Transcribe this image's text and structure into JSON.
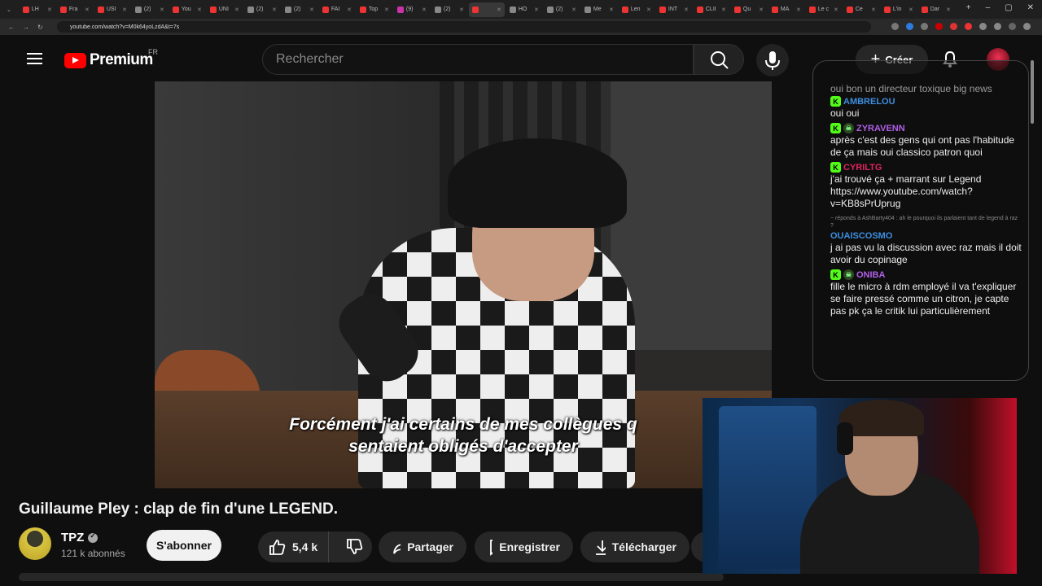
{
  "browser": {
    "tabs": [
      {
        "label": "LH",
        "color": "#e33"
      },
      {
        "label": "Fra",
        "color": "#e33"
      },
      {
        "label": "USI",
        "color": "#e33"
      },
      {
        "label": "(2)",
        "color": "#888"
      },
      {
        "label": "You",
        "color": "#e33"
      },
      {
        "label": "UNI",
        "color": "#e33"
      },
      {
        "label": "(2)",
        "color": "#888"
      },
      {
        "label": "(2)",
        "color": "#888"
      },
      {
        "label": "FAI",
        "color": "#e33"
      },
      {
        "label": "Top",
        "color": "#e33"
      },
      {
        "label": "(9)",
        "color": "#c3a"
      },
      {
        "label": "(2)",
        "color": "#888"
      },
      {
        "label": "",
        "color": "#e33",
        "active": true
      },
      {
        "label": "HO",
        "color": "#888"
      },
      {
        "label": "(2)",
        "color": "#888"
      },
      {
        "label": "Me",
        "color": "#888"
      },
      {
        "label": "Len",
        "color": "#e33"
      },
      {
        "label": "INT",
        "color": "#e33"
      },
      {
        "label": "CLII",
        "color": "#e33"
      },
      {
        "label": "Qu",
        "color": "#e33"
      },
      {
        "label": "MA",
        "color": "#e33"
      },
      {
        "label": "Le c",
        "color": "#e33"
      },
      {
        "label": "Ce",
        "color": "#e33"
      },
      {
        "label": "L'in",
        "color": "#e33"
      },
      {
        "label": "Dar",
        "color": "#e33"
      }
    ],
    "url": "youtube.com/watch?v=M0k64yoLzdA&t=7s"
  },
  "header": {
    "logo_text": "Premium",
    "logo_region": "FR",
    "search_placeholder": "Rechercher",
    "create_label": "Créer"
  },
  "video": {
    "subtitle_line1": "Forcément j'ai certains de mes collègues q",
    "subtitle_line2": "sentaient obligés d'accepter",
    "title": "Guillaume Pley : clap de fin d'une LEGEND."
  },
  "channel": {
    "name": "TPZ",
    "subscribers": "121 k abonnés",
    "subscribe_label": "S'abonner"
  },
  "actions": {
    "likes": "5,4 k",
    "share_label": "Partager",
    "save_label": "Enregistrer",
    "download_label": "Télécharger"
  },
  "chat": {
    "partial_top": "oui bon un directeur toxique big news",
    "messages": [
      {
        "user": "AMBRELOU",
        "color": "#3d8fe0",
        "skull": false,
        "text": "oui oui"
      },
      {
        "user": "ZYRAVENN",
        "color": "#b05fe8",
        "skull": true,
        "text": "après c'est des gens qui ont pas l'habitude de ça mais oui classico patron quoi"
      },
      {
        "user": "CYRILTG",
        "color": "#e0245e",
        "skull": false,
        "text": "j'ai trouvé ça + marrant sur Legend https://www.youtube.com/watch?v=KB8sPrUprug"
      },
      {
        "reply_to": "~ réponds à AshBarty404 : ah le pourquoi ils parlaient tant de legend à raz ?",
        "user": "OUAISCOSMO",
        "color": "#3d8fe0",
        "skull": false,
        "no_badge": true,
        "text": "j ai pas vu la discussion avec raz mais il doit avoir du copinage"
      },
      {
        "user": "ONIBA",
        "color": "#b05fe8",
        "skull": true,
        "text": "fille le micro à rdm employé il va t'expliquer se faire pressé comme un citron, je capte pas pk ça le critik lui particulièrement"
      }
    ]
  }
}
